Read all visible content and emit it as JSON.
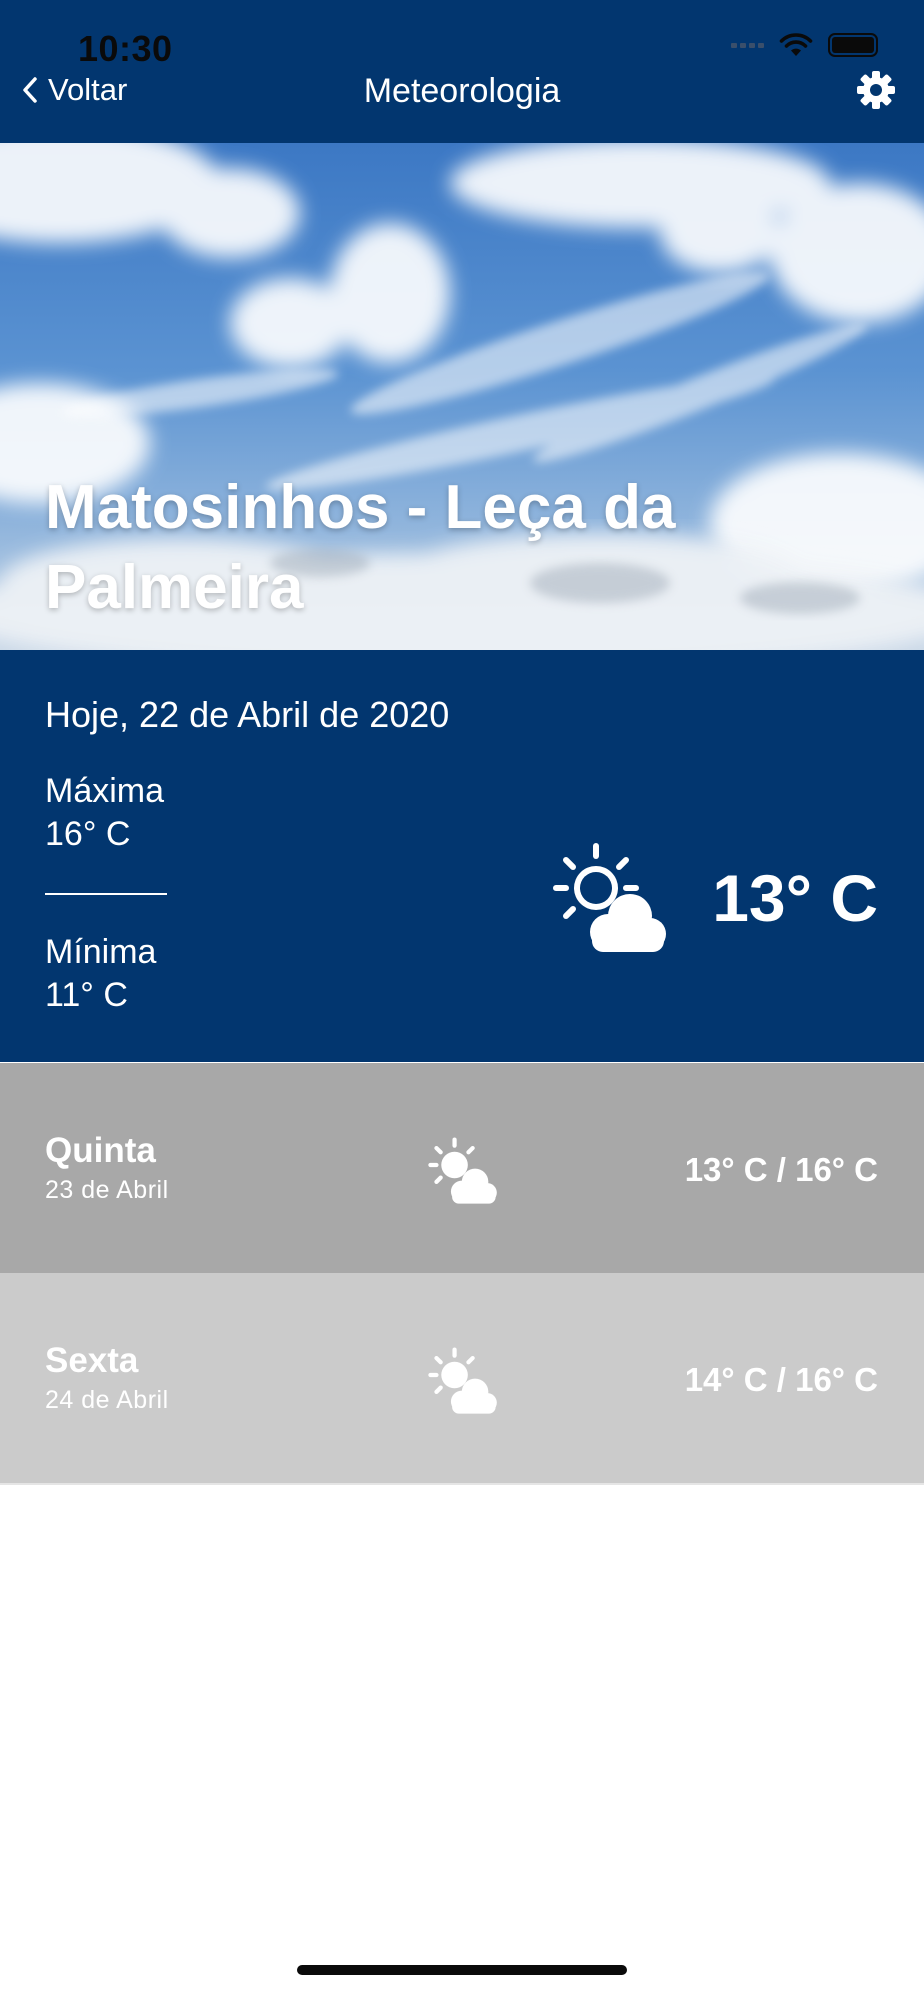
{
  "status_bar": {
    "time": "10:30"
  },
  "nav": {
    "back_label": "Voltar",
    "title": "Meteorologia"
  },
  "hero": {
    "location": "Matosinhos - Leça da Palmeira"
  },
  "today": {
    "date": "Hoje, 22 de Abril de 2020",
    "max_label": "Máxima",
    "max_value": "16° C",
    "min_label": "Mínima",
    "min_value": "11° C",
    "current_temp": "13° C",
    "icon": "partly-cloudy-icon"
  },
  "forecast": [
    {
      "day": "Quinta",
      "date": "23 de Abril",
      "temps": "13° C / 16° C",
      "icon": "partly-cloudy-icon"
    },
    {
      "day": "Sexta",
      "date": "24 de Abril",
      "temps": "14° C / 16° C",
      "icon": "partly-cloudy-icon"
    }
  ],
  "colors": {
    "header": "#02366f",
    "today_panel": "#02366f",
    "forecast_row_1": "#a8a8a8",
    "forecast_row_2": "#cbcbcb"
  }
}
